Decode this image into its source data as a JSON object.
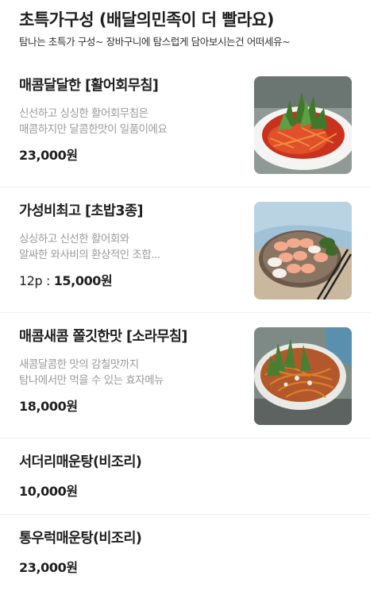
{
  "header": {
    "title": "초특가구성 (배달의민족이 더 빨라요)",
    "subtitle": "탐나는 초특가 구성~ 장바구니에 탐스럽게 담아보시는건 어떠세유~"
  },
  "menu": [
    {
      "name": "매콤달달한 [활어회무침]",
      "desc": [
        "신선하고 싱싱한 활어회무침은",
        "매콤하지만 달콤한맛이 일품이에요"
      ],
      "price_prefix": "",
      "price": "23,000원",
      "image_icon": "spicy-raw-fish-salad-photo"
    },
    {
      "name": "가성비최고 [초밥3종]",
      "desc": [
        "싱싱하고 신선한 활어회와",
        "알싸한 와사비의 환상적인 조합..."
      ],
      "price_prefix": "12p : ",
      "price": "15,000원",
      "image_icon": "sushi-platter-photo"
    },
    {
      "name": "매콤새콤 쫄깃한맛 [소라무침]",
      "desc": [
        "새콤달콤한 맛의 감칠맛까지",
        "탐나에서만 먹을 수 있는 효자메뉴"
      ],
      "price_prefix": "",
      "price": "18,000원",
      "image_icon": "spicy-conch-salad-photo"
    },
    {
      "name": "서더리매운탕(비조리)",
      "price_prefix": "",
      "price": "10,000원"
    },
    {
      "name": "통우럭매운탕(비조리)",
      "price_prefix": "",
      "price": "23,000원"
    }
  ]
}
